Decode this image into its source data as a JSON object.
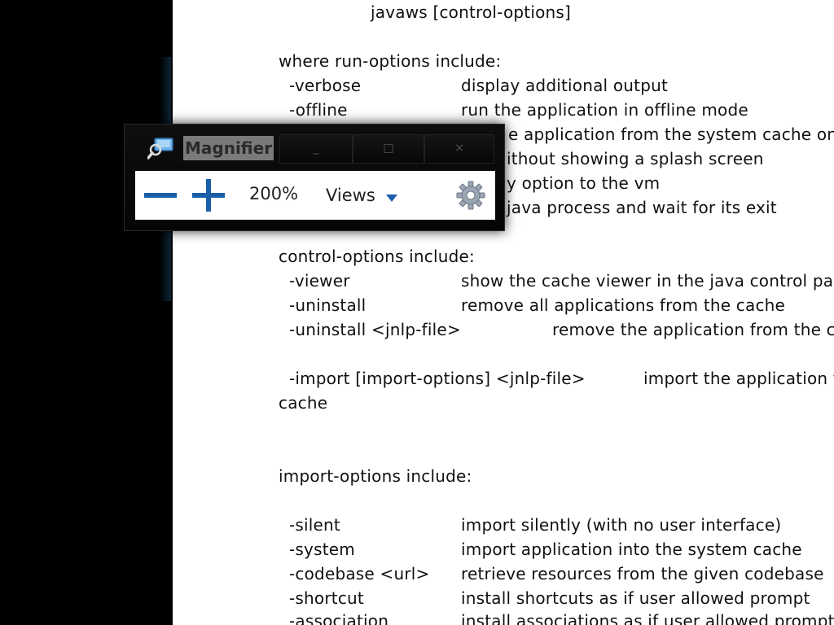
{
  "document": {
    "lines": [
      "javaws [control-options]",
      "where run-options include:",
      "-verbose",
      "display additional output",
      "-offline",
      "run the application in offline mode",
      "e application from the system cache only",
      "ithout showing a splash screen",
      "y option to the vm",
      "java process and wait for its exit",
      "control-options include:",
      "-viewer",
      "show the cache viewer in the java control panel",
      "-uninstall",
      "remove all applications from the cache",
      "-uninstall <jnlp-file>",
      "remove the application from the cache",
      "-import [import-options] <jnlp-file>",
      "import the application to the",
      "cache",
      "import-options include:",
      "-silent",
      "import silently (with no user interface)",
      "-system",
      "import application into the system cache",
      "-codebase <url>",
      "retrieve resources from the given codebase",
      "-shortcut",
      "install shortcuts as if user allowed prompt",
      "-association",
      "install associations as if user allowed prompt"
    ]
  },
  "magnifier": {
    "title": "Magnifier",
    "minimize_glyph": "_",
    "maximize_glyph": "□",
    "close_glyph": "×",
    "zoom_level": "200%",
    "views_label": "Views",
    "icons": {
      "app": "magnifier-app-icon",
      "zoom_out": "minus-icon",
      "zoom_in": "plus-icon",
      "views_caret": "caret-down-icon",
      "options": "gear-icon"
    },
    "accent_color": "#1a5ea8"
  }
}
